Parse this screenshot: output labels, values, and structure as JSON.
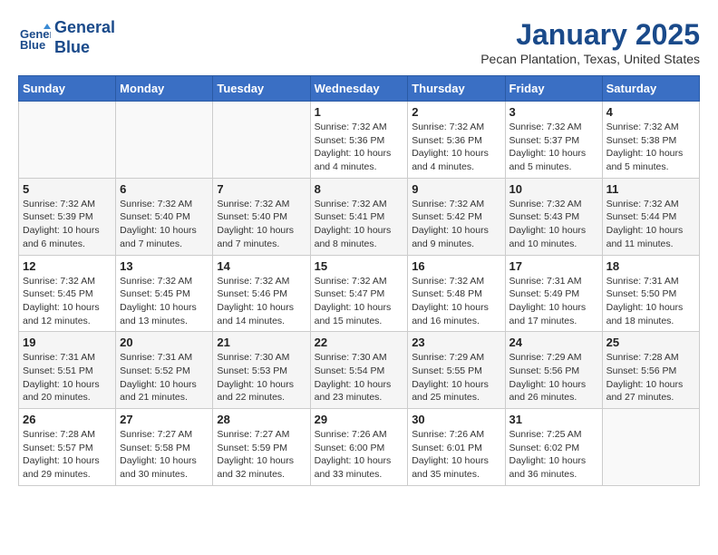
{
  "logo": {
    "line1": "General",
    "line2": "Blue"
  },
  "calendar": {
    "title": "January 2025",
    "subtitle": "Pecan Plantation, Texas, United States"
  },
  "weekdays": [
    "Sunday",
    "Monday",
    "Tuesday",
    "Wednesday",
    "Thursday",
    "Friday",
    "Saturday"
  ],
  "weeks": [
    [
      {
        "day": "",
        "info": ""
      },
      {
        "day": "",
        "info": ""
      },
      {
        "day": "",
        "info": ""
      },
      {
        "day": "1",
        "info": "Sunrise: 7:32 AM\nSunset: 5:36 PM\nDaylight: 10 hours\nand 4 minutes."
      },
      {
        "day": "2",
        "info": "Sunrise: 7:32 AM\nSunset: 5:36 PM\nDaylight: 10 hours\nand 4 minutes."
      },
      {
        "day": "3",
        "info": "Sunrise: 7:32 AM\nSunset: 5:37 PM\nDaylight: 10 hours\nand 5 minutes."
      },
      {
        "day": "4",
        "info": "Sunrise: 7:32 AM\nSunset: 5:38 PM\nDaylight: 10 hours\nand 5 minutes."
      }
    ],
    [
      {
        "day": "5",
        "info": "Sunrise: 7:32 AM\nSunset: 5:39 PM\nDaylight: 10 hours\nand 6 minutes."
      },
      {
        "day": "6",
        "info": "Sunrise: 7:32 AM\nSunset: 5:40 PM\nDaylight: 10 hours\nand 7 minutes."
      },
      {
        "day": "7",
        "info": "Sunrise: 7:32 AM\nSunset: 5:40 PM\nDaylight: 10 hours\nand 7 minutes."
      },
      {
        "day": "8",
        "info": "Sunrise: 7:32 AM\nSunset: 5:41 PM\nDaylight: 10 hours\nand 8 minutes."
      },
      {
        "day": "9",
        "info": "Sunrise: 7:32 AM\nSunset: 5:42 PM\nDaylight: 10 hours\nand 9 minutes."
      },
      {
        "day": "10",
        "info": "Sunrise: 7:32 AM\nSunset: 5:43 PM\nDaylight: 10 hours\nand 10 minutes."
      },
      {
        "day": "11",
        "info": "Sunrise: 7:32 AM\nSunset: 5:44 PM\nDaylight: 10 hours\nand 11 minutes."
      }
    ],
    [
      {
        "day": "12",
        "info": "Sunrise: 7:32 AM\nSunset: 5:45 PM\nDaylight: 10 hours\nand 12 minutes."
      },
      {
        "day": "13",
        "info": "Sunrise: 7:32 AM\nSunset: 5:45 PM\nDaylight: 10 hours\nand 13 minutes."
      },
      {
        "day": "14",
        "info": "Sunrise: 7:32 AM\nSunset: 5:46 PM\nDaylight: 10 hours\nand 14 minutes."
      },
      {
        "day": "15",
        "info": "Sunrise: 7:32 AM\nSunset: 5:47 PM\nDaylight: 10 hours\nand 15 minutes."
      },
      {
        "day": "16",
        "info": "Sunrise: 7:32 AM\nSunset: 5:48 PM\nDaylight: 10 hours\nand 16 minutes."
      },
      {
        "day": "17",
        "info": "Sunrise: 7:31 AM\nSunset: 5:49 PM\nDaylight: 10 hours\nand 17 minutes."
      },
      {
        "day": "18",
        "info": "Sunrise: 7:31 AM\nSunset: 5:50 PM\nDaylight: 10 hours\nand 18 minutes."
      }
    ],
    [
      {
        "day": "19",
        "info": "Sunrise: 7:31 AM\nSunset: 5:51 PM\nDaylight: 10 hours\nand 20 minutes."
      },
      {
        "day": "20",
        "info": "Sunrise: 7:31 AM\nSunset: 5:52 PM\nDaylight: 10 hours\nand 21 minutes."
      },
      {
        "day": "21",
        "info": "Sunrise: 7:30 AM\nSunset: 5:53 PM\nDaylight: 10 hours\nand 22 minutes."
      },
      {
        "day": "22",
        "info": "Sunrise: 7:30 AM\nSunset: 5:54 PM\nDaylight: 10 hours\nand 23 minutes."
      },
      {
        "day": "23",
        "info": "Sunrise: 7:29 AM\nSunset: 5:55 PM\nDaylight: 10 hours\nand 25 minutes."
      },
      {
        "day": "24",
        "info": "Sunrise: 7:29 AM\nSunset: 5:56 PM\nDaylight: 10 hours\nand 26 minutes."
      },
      {
        "day": "25",
        "info": "Sunrise: 7:28 AM\nSunset: 5:56 PM\nDaylight: 10 hours\nand 27 minutes."
      }
    ],
    [
      {
        "day": "26",
        "info": "Sunrise: 7:28 AM\nSunset: 5:57 PM\nDaylight: 10 hours\nand 29 minutes."
      },
      {
        "day": "27",
        "info": "Sunrise: 7:27 AM\nSunset: 5:58 PM\nDaylight: 10 hours\nand 30 minutes."
      },
      {
        "day": "28",
        "info": "Sunrise: 7:27 AM\nSunset: 5:59 PM\nDaylight: 10 hours\nand 32 minutes."
      },
      {
        "day": "29",
        "info": "Sunrise: 7:26 AM\nSunset: 6:00 PM\nDaylight: 10 hours\nand 33 minutes."
      },
      {
        "day": "30",
        "info": "Sunrise: 7:26 AM\nSunset: 6:01 PM\nDaylight: 10 hours\nand 35 minutes."
      },
      {
        "day": "31",
        "info": "Sunrise: 7:25 AM\nSunset: 6:02 PM\nDaylight: 10 hours\nand 36 minutes."
      },
      {
        "day": "",
        "info": ""
      }
    ]
  ]
}
